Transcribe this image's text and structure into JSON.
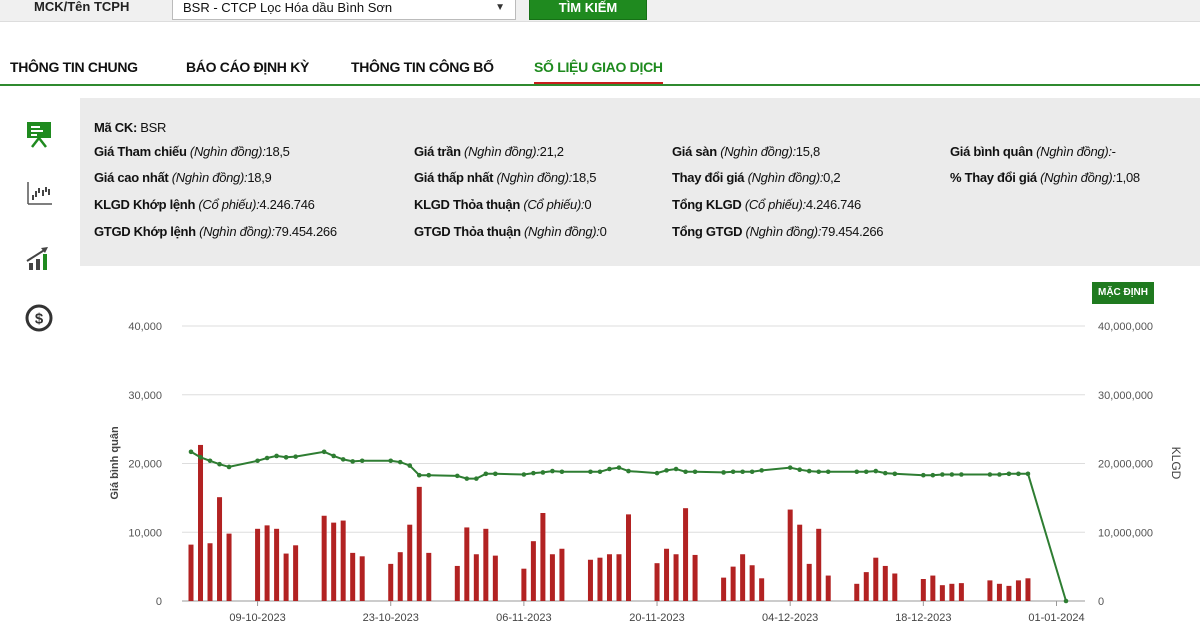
{
  "search": {
    "label": "MCK/Tên TCPH",
    "selected_stock": "BSR - CTCP Lọc Hóa dầu Bình Sơn",
    "button_label": "TÌM KIẾM"
  },
  "tabs": [
    {
      "label": "THÔNG TIN CHUNG",
      "active": false
    },
    {
      "label": "BÁO CÁO ĐỊNH KỲ",
      "active": false
    },
    {
      "label": "THÔNG TIN CÔNG BỐ",
      "active": false
    },
    {
      "label": "SỐ LIỆU GIAO DỊCH",
      "active": true
    }
  ],
  "sidebar_icons": [
    "presentation-board-icon",
    "scatter-chart-icon",
    "growth-chart-icon",
    "dollar-coin-icon"
  ],
  "info": {
    "code_label": "Mã CK:",
    "code_value": "BSR",
    "items": [
      {
        "label": "Giá Tham chiếu",
        "unit": "(Nghìn đồng):",
        "value": "18,5"
      },
      {
        "label": "Giá trần",
        "unit": "(Nghìn đồng):",
        "value": "21,2"
      },
      {
        "label": "Giá sàn",
        "unit": "(Nghìn đồng):",
        "value": "15,8"
      },
      {
        "label": "Giá bình quân",
        "unit": "(Nghìn đồng):",
        "value": "-"
      },
      {
        "label": "Giá cao nhất",
        "unit": "(Nghìn đồng):",
        "value": "18,9"
      },
      {
        "label": "Giá thấp nhất",
        "unit": "(Nghìn đồng):",
        "value": "18,5"
      },
      {
        "label": "Thay đổi giá",
        "unit": "(Nghìn đồng):",
        "value": "0,2"
      },
      {
        "label": "% Thay đổi giá",
        "unit": "(Nghìn đồng):",
        "value": "1,08"
      },
      {
        "label": "KLGD Khớp lệnh",
        "unit": "(Cổ phiếu):",
        "value": "4.246.746"
      },
      {
        "label": "KLGD Thỏa thuận",
        "unit": "(Cổ phiếu):",
        "value": "0"
      },
      {
        "label": "Tổng KLGD",
        "unit": "(Cổ phiếu):",
        "value": "4.246.746"
      },
      {
        "label": "GTGD Khớp lệnh",
        "unit": "(Nghìn đồng):",
        "value": "79.454.266"
      },
      {
        "label": "GTGD Thỏa thuận",
        "unit": "(Nghìn đồng):",
        "value": "0"
      },
      {
        "label": "Tổng GTGD",
        "unit": "(Nghìn đồng):",
        "value": "79.454.266"
      }
    ]
  },
  "chart_controls": {
    "default_label": "MẶC ĐỊNH"
  },
  "colors": {
    "accent": "#1f8a1f",
    "tab_underline": "#c81e1e",
    "bar": "#b22222",
    "line": "#2e7d32"
  },
  "chart_data": {
    "type": "bar+line",
    "ylabel": "Giá bình quân",
    "y2label": "KLGD",
    "ylim": [
      0,
      40000
    ],
    "y2lim": [
      0,
      40000000
    ],
    "y_ticks": [
      "0",
      "10,000",
      "20,000",
      "30,000",
      "40,000"
    ],
    "y2_ticks": [
      "0",
      "10,000,000",
      "20,000,000",
      "30,000,000",
      "40,000,000"
    ],
    "x_ticks": [
      "09-10-2023",
      "23-10-2023",
      "06-11-2023",
      "20-11-2023",
      "04-12-2023",
      "18-12-2023",
      "01-01-2024"
    ],
    "grid": true,
    "series": [
      {
        "kind": "bar",
        "axis": "right",
        "x": [
          "2023-10-02",
          "2023-10-03",
          "2023-10-04",
          "2023-10-05",
          "2023-10-06",
          "2023-10-09",
          "2023-10-10",
          "2023-10-11",
          "2023-10-12",
          "2023-10-13",
          "2023-10-16",
          "2023-10-17",
          "2023-10-18",
          "2023-10-19",
          "2023-10-20",
          "2023-10-23",
          "2023-10-24",
          "2023-10-25",
          "2023-10-26",
          "2023-10-27",
          "2023-10-30",
          "2023-10-31",
          "2023-11-01",
          "2023-11-02",
          "2023-11-03",
          "2023-11-06",
          "2023-11-07",
          "2023-11-08",
          "2023-11-09",
          "2023-11-10",
          "2023-11-13",
          "2023-11-14",
          "2023-11-15",
          "2023-11-16",
          "2023-11-17",
          "2023-11-20",
          "2023-11-21",
          "2023-11-22",
          "2023-11-23",
          "2023-11-24",
          "2023-11-27",
          "2023-11-28",
          "2023-11-29",
          "2023-11-30",
          "2023-12-01",
          "2023-12-04",
          "2023-12-05",
          "2023-12-06",
          "2023-12-07",
          "2023-12-08",
          "2023-12-11",
          "2023-12-12",
          "2023-12-13",
          "2023-12-14",
          "2023-12-15",
          "2023-12-18",
          "2023-12-19",
          "2023-12-20",
          "2023-12-21",
          "2023-12-22",
          "2023-12-25",
          "2023-12-26",
          "2023-12-27",
          "2023-12-28",
          "2023-12-29"
        ],
        "values": [
          8200000,
          22700000,
          8400000,
          15100000,
          9800000,
          10500000,
          11000000,
          10500000,
          6900000,
          8100000,
          12400000,
          11400000,
          11700000,
          7000000,
          6500000,
          5400000,
          7100000,
          11100000,
          16600000,
          7000000,
          5100000,
          10700000,
          6800000,
          10500000,
          6600000,
          4700000,
          8700000,
          12800000,
          6800000,
          7600000,
          6000000,
          6300000,
          6800000,
          6800000,
          12600000,
          5500000,
          7600000,
          6800000,
          13500000,
          6700000,
          3400000,
          5000000,
          6800000,
          5200000,
          3300000,
          13300000,
          11100000,
          5400000,
          10500000,
          3700000,
          2500000,
          4200000,
          6300000,
          5100000,
          4000000,
          3200000,
          3700000,
          2300000,
          2500000,
          2600000,
          3000000,
          2500000,
          2200000,
          3000000,
          3300000
        ]
      },
      {
        "kind": "line",
        "axis": "left",
        "x": [
          "2023-10-02",
          "2023-10-03",
          "2023-10-04",
          "2023-10-05",
          "2023-10-06",
          "2023-10-09",
          "2023-10-10",
          "2023-10-11",
          "2023-10-12",
          "2023-10-13",
          "2023-10-16",
          "2023-10-17",
          "2023-10-18",
          "2023-10-19",
          "2023-10-20",
          "2023-10-23",
          "2023-10-24",
          "2023-10-25",
          "2023-10-26",
          "2023-10-27",
          "2023-10-30",
          "2023-10-31",
          "2023-11-01",
          "2023-11-02",
          "2023-11-03",
          "2023-11-06",
          "2023-11-07",
          "2023-11-08",
          "2023-11-09",
          "2023-11-10",
          "2023-11-13",
          "2023-11-14",
          "2023-11-15",
          "2023-11-16",
          "2023-11-17",
          "2023-11-20",
          "2023-11-21",
          "2023-11-22",
          "2023-11-23",
          "2023-11-24",
          "2023-11-27",
          "2023-11-28",
          "2023-11-29",
          "2023-11-30",
          "2023-12-01",
          "2023-12-04",
          "2023-12-05",
          "2023-12-06",
          "2023-12-07",
          "2023-12-08",
          "2023-12-11",
          "2023-12-12",
          "2023-12-13",
          "2023-12-14",
          "2023-12-15",
          "2023-12-18",
          "2023-12-19",
          "2023-12-20",
          "2023-12-21",
          "2023-12-22",
          "2023-12-25",
          "2023-12-26",
          "2023-12-27",
          "2023-12-28",
          "2023-12-29",
          "2024-01-02"
        ],
        "values": [
          21700,
          20900,
          20400,
          19900,
          19500,
          20400,
          20800,
          21100,
          20900,
          21000,
          21700,
          21100,
          20600,
          20300,
          20400,
          20400,
          20200,
          19700,
          18300,
          18300,
          18200,
          17800,
          17800,
          18500,
          18500,
          18400,
          18600,
          18700,
          18900,
          18800,
          18800,
          18800,
          19200,
          19400,
          18900,
          18600,
          19000,
          19200,
          18800,
          18800,
          18700,
          18800,
          18800,
          18800,
          19000,
          19400,
          19100,
          18900,
          18800,
          18800,
          18800,
          18800,
          18900,
          18600,
          18500,
          18300,
          18300,
          18400,
          18400,
          18400,
          18400,
          18400,
          18500,
          18500,
          18500,
          0
        ]
      }
    ]
  }
}
